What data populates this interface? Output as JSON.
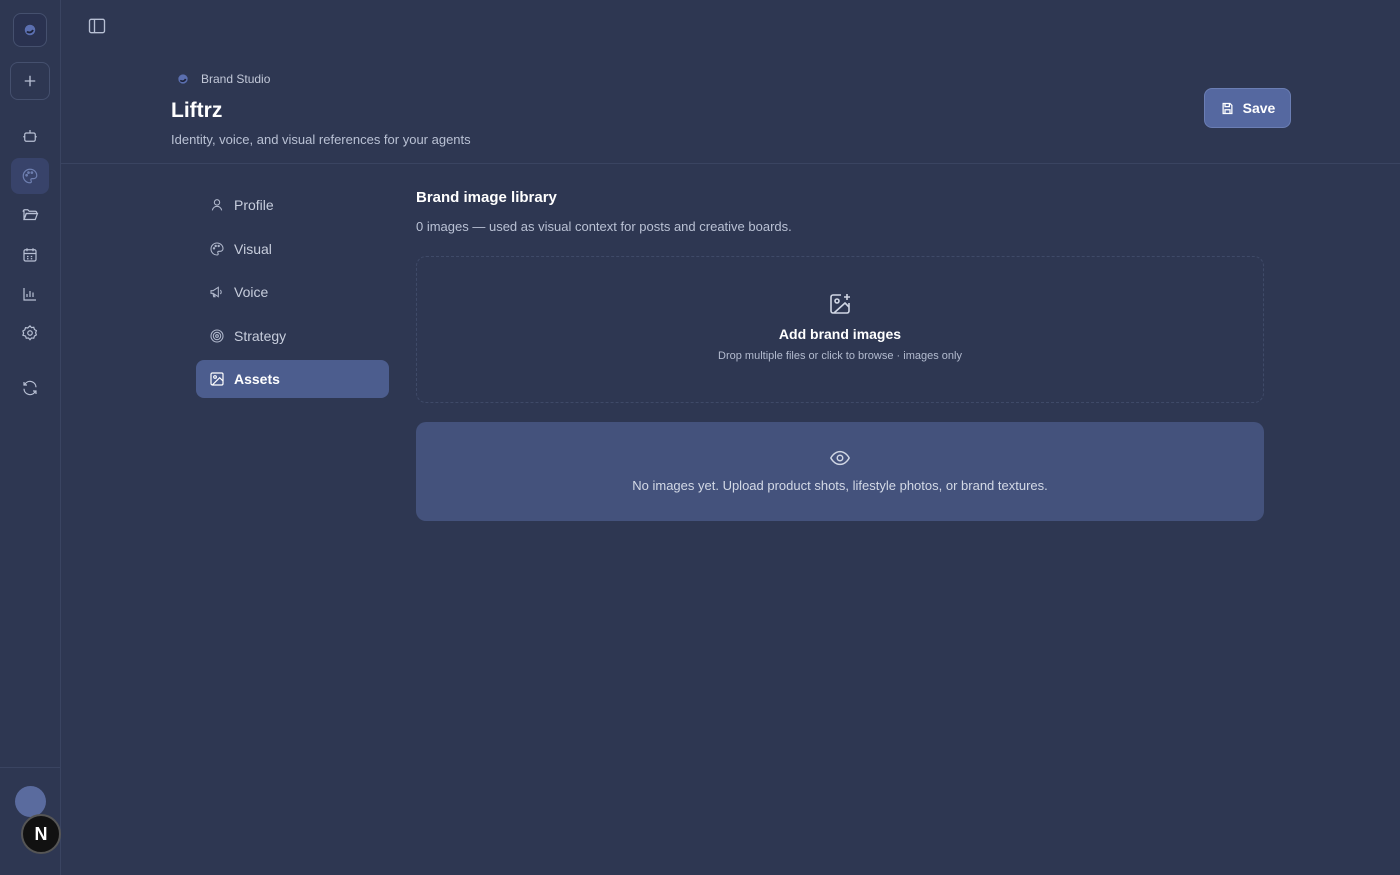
{
  "header": {
    "breadcrumb": "Brand Studio",
    "title": "Liftrz",
    "subtitle": "Identity, voice, and visual references for your agents",
    "save_label": "Save"
  },
  "rail": {
    "items": [
      "new-icon",
      "bot-icon",
      "palette-icon",
      "folder-icon",
      "calendar-icon",
      "chart-icon",
      "gear-icon",
      "refresh-icon"
    ],
    "active": "palette-icon",
    "badge": "N"
  },
  "subnav": {
    "items": [
      {
        "label": "Profile",
        "icon": "user-icon"
      },
      {
        "label": "Visual",
        "icon": "palette-icon"
      },
      {
        "label": "Voice",
        "icon": "megaphone-icon"
      },
      {
        "label": "Strategy",
        "icon": "target-icon"
      },
      {
        "label": "Assets",
        "icon": "image-icon"
      }
    ],
    "active": "Assets"
  },
  "library": {
    "title": "Brand image library",
    "description": "0 images — used as visual context for posts and creative boards.",
    "dropzone_title": "Add brand images",
    "dropzone_hint": "Drop multiple files or click to browse · images only",
    "empty_text": "No images yet. Upload product shots, lifestyle photos, or brand textures."
  },
  "colors": {
    "background": "#2e3752",
    "accent": "#5568a0",
    "active_nav": "#4c5d8e",
    "empty_panel": "#44527c"
  }
}
